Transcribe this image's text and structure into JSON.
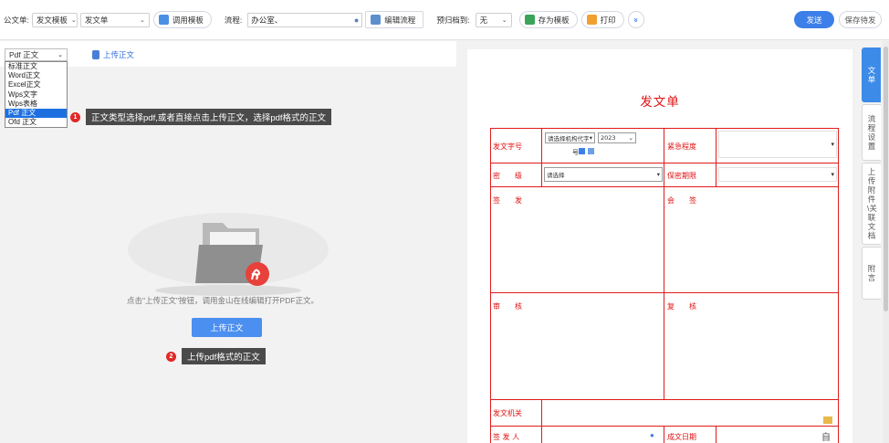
{
  "toolbar": {
    "doc_type_label": "公文单:",
    "template_value": "发文模板",
    "form_value": "发文单",
    "call_template_label": "调用模板",
    "flow_label": "流程:",
    "flow_value": "办公室、",
    "edit_flow_label": "编辑流程",
    "archive_label": "预归档到:",
    "archive_value": "无",
    "save_template_label": "存为模板",
    "print_label": "打印",
    "more_label": "»",
    "send_label": "发送",
    "save_pending_label": "保存待发"
  },
  "left": {
    "doc_select_value": "Pdf 正文",
    "upload_link": "上传正文",
    "dropdown_options": [
      "标准正文",
      "Word正文",
      "Excel正文",
      "Wps文字",
      "Wps表格",
      "Pdf 正文",
      "Ofd 正文"
    ],
    "selected_option": "Pdf 正文",
    "tip1_badge": "1",
    "tip1_text": "正文类型选择pdf,或者直接点击上传正文，选择pdf格式的正文",
    "hint_text": "点击\"上传正文\"按钮，调用金山在线编辑打开PDF正文。",
    "upload_button": "上传正文",
    "tip2_badge": "2",
    "tip2_text": "上传pdf格式的正文"
  },
  "form": {
    "title": "发文单",
    "doc_number_label": "发文字号",
    "doc_number_select": "请选择机构代字",
    "year_value": "2023",
    "number_suffix": "号",
    "urgency_label": "紧急程度",
    "security_label": "密　　级",
    "security_select": "请选择",
    "secret_period_label": "保密期限",
    "sign_label": "签　　发",
    "countersign_label": "会　　签",
    "review_label": "审　　核",
    "recheck_label": "复　　核",
    "issuing_org_label": "发文机关",
    "sender_label": "签 发 人",
    "date_label": "成文日期",
    "date_icon_char": "自"
  },
  "side_tabs": [
    "文单",
    "流程设置",
    "上传附件\\关联文档",
    "附言"
  ],
  "colors": {
    "accent": "#3d7fe8",
    "form_red": "#e11b1b",
    "tip_bg": "#4a4a4a",
    "badge_red": "#e02828",
    "selected_option_bg": "#1e70e0"
  }
}
